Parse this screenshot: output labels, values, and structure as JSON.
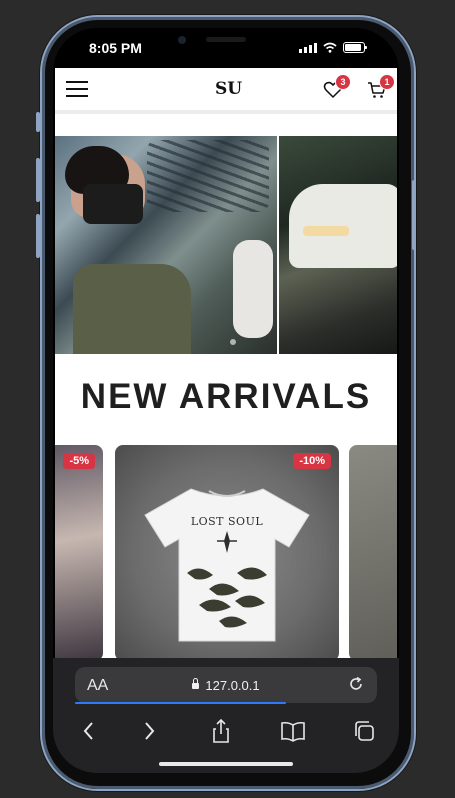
{
  "status": {
    "time": "8:05 PM"
  },
  "header": {
    "logo_text": "SU",
    "wishlist_count": "3",
    "cart_count": "1"
  },
  "hero": {
    "slide_count": 2,
    "active_slide": 1
  },
  "section": {
    "title": "NEW ARRIVALS"
  },
  "products": [
    {
      "discount": "-5%"
    },
    {
      "discount": "-10%",
      "print_text": "LOST SOUL"
    },
    {
      "discount": ""
    }
  ],
  "browser": {
    "aa_label": "AA",
    "url": "127.0.0.1",
    "load_progress": 0.7
  },
  "colors": {
    "badge": "#d73444",
    "accent_progress": "#2c7bff",
    "frame": "#8ea4c2"
  }
}
